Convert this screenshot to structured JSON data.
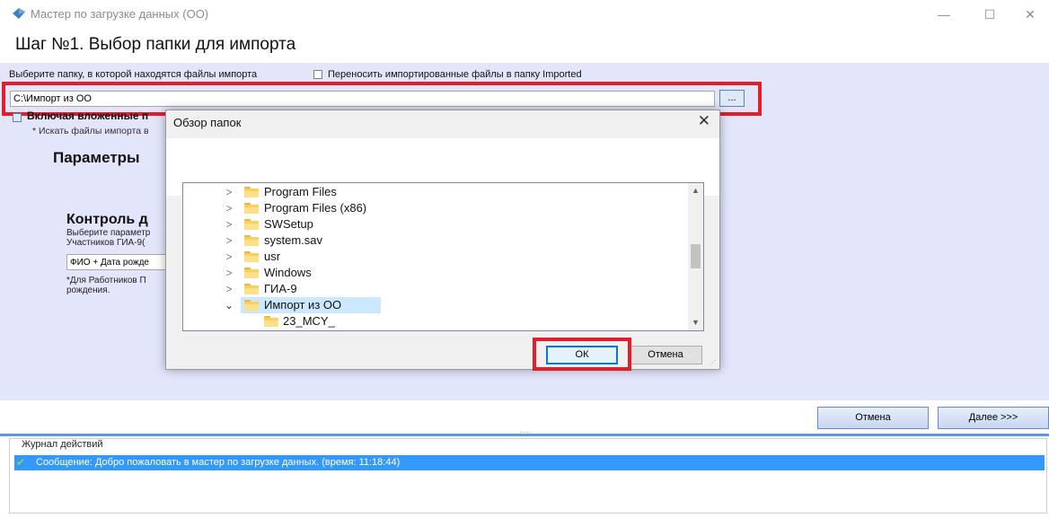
{
  "window": {
    "title": "Мастер по загрузке данных (ОО)",
    "minimize": "—",
    "maximize": "☐",
    "close": "✕"
  },
  "step_title": "Шаг №1.  Выбор папки для импорта",
  "folder_section": {
    "select_label": "Выберите папку, в которой находятся файлы импорта",
    "move_label": "Переносить импортированные файлы в папку Imported",
    "path_value": "C:\\Импорт из ОО",
    "browse_label": "...",
    "include_label": "Включая вложенные п",
    "include_note": "* Искать файлы импорта в"
  },
  "params_title": "Параметры",
  "control": {
    "title": "Контроль д",
    "desc_line1": "Выберите параметр",
    "desc_line2": "Участников ГИА-9(",
    "combo_value": "ФИО + Дата рожде",
    "note_line1": "*Для Работников П",
    "note_line2": "рождения."
  },
  "dialog": {
    "title": "Обзор папок",
    "close": "✕",
    "folders": [
      {
        "name": "Program Files",
        "expander": ">",
        "selected": false
      },
      {
        "name": "Program Files (x86)",
        "expander": ">",
        "selected": false
      },
      {
        "name": "SWSetup",
        "expander": ">",
        "selected": false
      },
      {
        "name": "system.sav",
        "expander": ">",
        "selected": false
      },
      {
        "name": "usr",
        "expander": ">",
        "selected": false
      },
      {
        "name": "Windows",
        "expander": ">",
        "selected": false
      },
      {
        "name": "ГИА-9",
        "expander": ">",
        "selected": false
      },
      {
        "name": "Импорт из ОО",
        "expander": "⌄",
        "selected": true
      },
      {
        "name": "23_MCY_",
        "expander": "",
        "selected": false,
        "child": true
      }
    ],
    "ok_label": "ОК",
    "cancel_label": "Отмена"
  },
  "footer": {
    "cancel_label": "Отмена",
    "next_label": "Далее >>>"
  },
  "journal": {
    "title": "Журнал действий",
    "entries": [
      {
        "text": "Сообщение: Добро пожаловать в мастер по загрузке данных. (время: 11:18:44)",
        "status": "success"
      }
    ]
  },
  "colors": {
    "main_bg": "#e3e5fb",
    "highlight_box": "#e21e2b",
    "selection": "#3399ff",
    "tree_selection": "#cce8ff",
    "button_border": "#0078d7"
  }
}
